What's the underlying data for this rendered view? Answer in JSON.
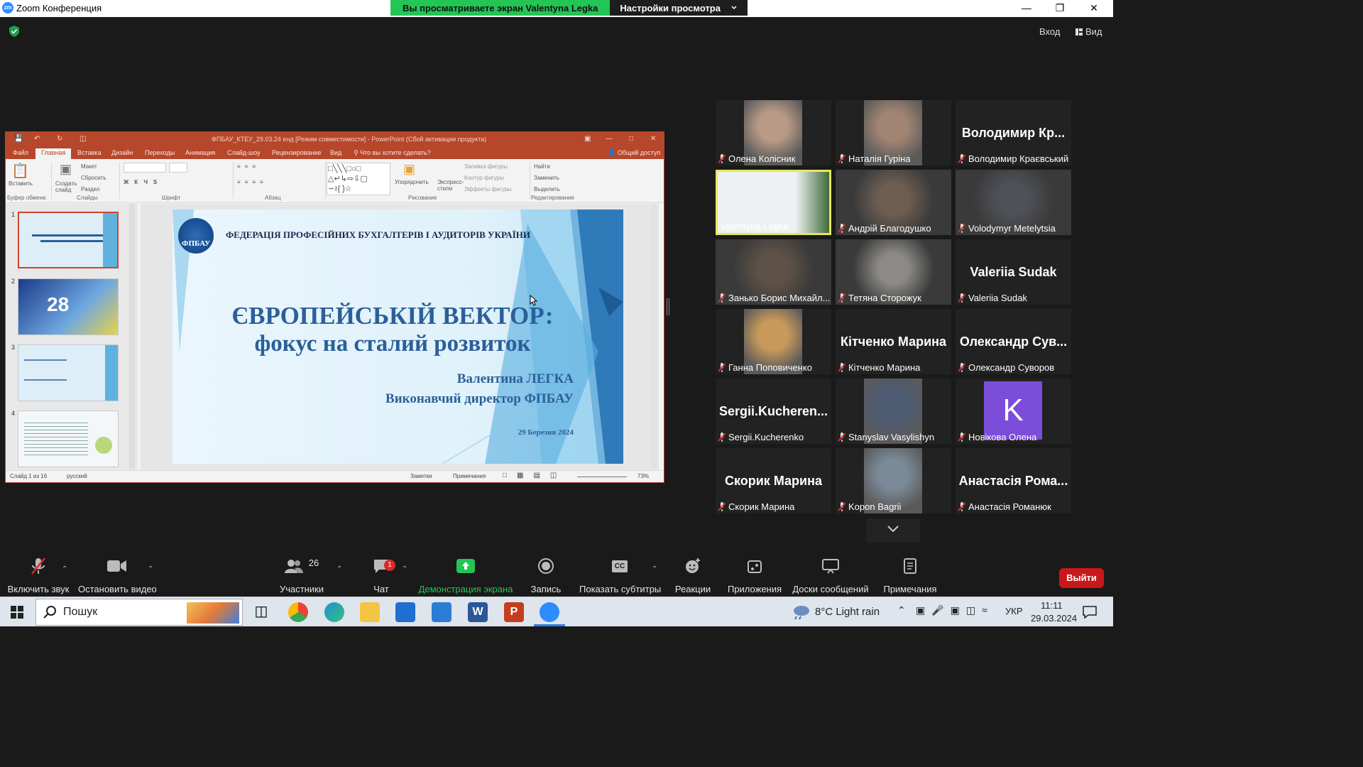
{
  "window": {
    "app_title": "Zoom Конференция",
    "logo_text": "zm"
  },
  "share_banner": {
    "viewing_text": "Вы просматриваете экран Valentynа Legka",
    "view_options": "Настройки просмотра"
  },
  "top_bar": {
    "login": "Вход",
    "view": "Вид"
  },
  "ppt": {
    "title": "ФПБАУ_КТЕУ_29.03.24 енд [Режим совместимости] - PowerPoint (Сбой активации продукта)",
    "tabs": [
      "Файл",
      "Главная",
      "Вставка",
      "Дизайн",
      "Переходы",
      "Анимация",
      "Слайд-шоу",
      "Рецензирование",
      "Вид"
    ],
    "tell_me": "Что вы хотите сделать?",
    "share": "Общий доступ",
    "ribbon": {
      "paste": "Вставить",
      "create_slide": "Создать слайд",
      "layout": "Макет",
      "reset": "Сбросить",
      "section": "Раздел",
      "arrange": "Упорядочить",
      "express_styles": "Экспресс-стили",
      "fill": "Заливка фигуры",
      "outline": "Контур фигуры",
      "effects": "Эффекты фигуры",
      "find": "Найти",
      "replace": "Заменить",
      "select": "Выделить",
      "groups": [
        "Буфер обмена",
        "Слайды",
        "Шрифт",
        "Абзац",
        "Рисование",
        "Редактирование"
      ]
    },
    "slide": {
      "org": "ФЕДЕРАЦІЯ ПРОФЕСІЙНИХ БУХГАЛТЕРІВ І АУДИТОРІВ УКРАЇНИ",
      "logo_text": "ФПБАУ",
      "title1": "ЄВРОПЕЙСЬКІЙ ВЕКТОР:",
      "title2": "фокус на сталий розвиток",
      "author": "Валентина ЛЕГКА",
      "role": "Виконавчий директор ФПБАУ",
      "date": "29 Березня 2024"
    },
    "thumbs": [
      "1",
      "2",
      "3",
      "4"
    ],
    "status": {
      "slide": "Слайд 1 из 16",
      "lang": "русский",
      "notes": "Заметки",
      "comments": "Примечания",
      "zoom": "73%"
    }
  },
  "participants": [
    {
      "name": "Олена Колісник",
      "big": ""
    },
    {
      "name": "Наталія Гуріна",
      "big": ""
    },
    {
      "name": "Володимир Краєвський",
      "big": "Володимир Кр..."
    },
    {
      "name": "Valentyna Legka",
      "big": ""
    },
    {
      "name": "Андрій Благодушко",
      "big": ""
    },
    {
      "name": "Volodymyr Metelytsia",
      "big": ""
    },
    {
      "name": "Занько Борис Михайл...",
      "big": ""
    },
    {
      "name": "Тетяна Сторожук",
      "big": ""
    },
    {
      "name": "Valeriia Sudak",
      "big": "Valeriia Sudak"
    },
    {
      "name": "Ганна Поповиченко",
      "big": ""
    },
    {
      "name": "Кітченко Марина",
      "big": "Кітченко Марина"
    },
    {
      "name": "Олександр Суворов",
      "big": "Олександр Сув..."
    },
    {
      "name": "Sergii.Kucherenko",
      "big": "Sergii.Kucheren..."
    },
    {
      "name": "Stanyslav Vasylishyn",
      "big": ""
    },
    {
      "name": "Новікова Олена",
      "big": ""
    },
    {
      "name": "Скорик Марина",
      "big": "Скорик Марина"
    },
    {
      "name": "Kopon Bagrii",
      "big": ""
    },
    {
      "name": "Анастасія Романюк",
      "big": "Анастасія Рома..."
    }
  ],
  "avatar_letter": "K",
  "toolbar": {
    "unmute": "Включить звук",
    "stop_video": "Остановить видео",
    "participants": "Участники",
    "participants_count": "26",
    "chat": "Чат",
    "chat_badge": "1",
    "share": "Демонстрация экрана",
    "record": "Запись",
    "captions": "Показать субтитры",
    "cc": "CC",
    "reactions": "Реакции",
    "apps": "Приложения",
    "whiteboards": "Доски сообщений",
    "notes": "Примечания",
    "leave": "Выйти"
  },
  "taskbar": {
    "search": "Пошук",
    "weather": "8°C  Light rain",
    "lang": "УКР",
    "time": "11:11",
    "date": "29.03.2024"
  },
  "colors": {
    "zoom_green": "#23c554",
    "ppt_red": "#b7472a",
    "leave_red": "#c8181c",
    "active_speaker": "#e6e85a"
  }
}
